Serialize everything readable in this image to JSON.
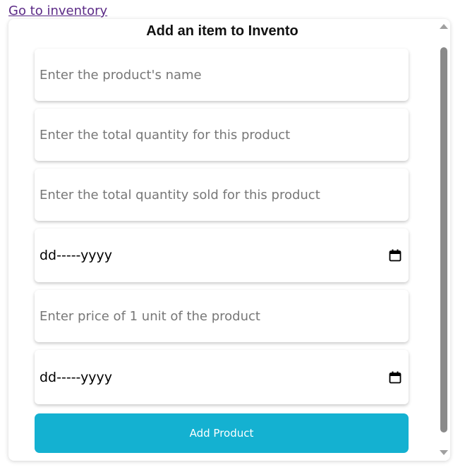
{
  "nav": {
    "link_label": "Go to inventory"
  },
  "form": {
    "title": "Add an item to Invento",
    "fields": {
      "name_placeholder": "Enter the product's name",
      "quantity_placeholder": "Enter the total quantity for this product",
      "sold_placeholder": "Enter the total quantity sold for this product",
      "date1_value": "dd-----yyyy",
      "price_placeholder": "Enter price of 1 unit of the product",
      "date2_value": "dd-----yyyy"
    },
    "submit_label": "Add Product"
  },
  "icons": {
    "date_picker": "calendar-icon"
  },
  "colors": {
    "button_bg": "#14b1d1",
    "link": "#5b2a86"
  }
}
